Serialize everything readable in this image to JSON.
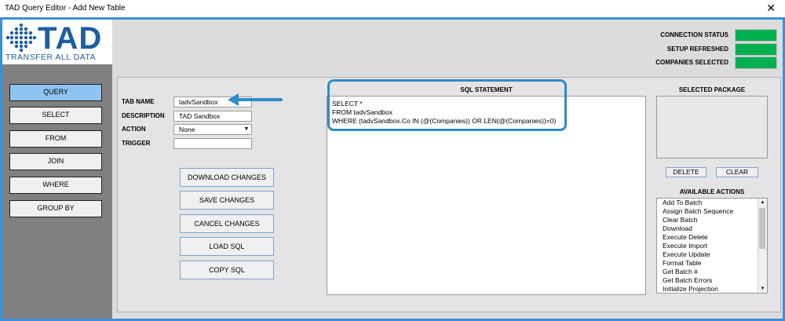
{
  "window": {
    "title": "TAD Query Editor - Add New Table",
    "close_glyph": "✕"
  },
  "logo": {
    "name": "TAD",
    "tagline": "TRANSFER ALL DATA"
  },
  "nav": [
    {
      "label": "QUERY",
      "active": true
    },
    {
      "label": "SELECT",
      "active": false
    },
    {
      "label": "FROM",
      "active": false
    },
    {
      "label": "JOIN",
      "active": false
    },
    {
      "label": "WHERE",
      "active": false
    },
    {
      "label": "GROUP BY",
      "active": false
    }
  ],
  "status": {
    "connection": "CONNECTION STATUS",
    "refreshed": "SETUP REFRESHED",
    "companies": "COMPANIES SELECTED",
    "color": "#00b050"
  },
  "fields": {
    "tab_name_label": "TAB NAME",
    "tab_name_value": "tadvSandbox",
    "description_label": "DESCRIPTION",
    "description_value": "TAD Sandbox",
    "action_label": "ACTION",
    "action_value": "None",
    "trigger_label": "TRIGGER",
    "trigger_value": ""
  },
  "actions": {
    "download": "DOWNLOAD CHANGES",
    "save": "SAVE CHANGES",
    "cancel": "CANCEL CHANGES",
    "load": "LOAD SQL",
    "copy": "COPY SQL"
  },
  "sql": {
    "heading": "SQL STATEMENT",
    "line1": "SELECT *",
    "line2": "FROM tadvSandbox",
    "line3": "WHERE (tadvSandbox.Co IN (@(Companies)) OR LEN(@(Companies))=0)"
  },
  "package": {
    "heading": "SELECTED PACKAGE",
    "delete": "DELETE",
    "clear": "CLEAR"
  },
  "available": {
    "heading": "AVAILABLE ACTIONS",
    "items": [
      "Add To Batch",
      "Assign Batch Sequence",
      "Clear Batch",
      "Download",
      "Execute Delete",
      "Execute Import",
      "Execute Update",
      "Format Table",
      "Get Batch #",
      "Get Batch Errors",
      "Initialize Projection"
    ]
  }
}
